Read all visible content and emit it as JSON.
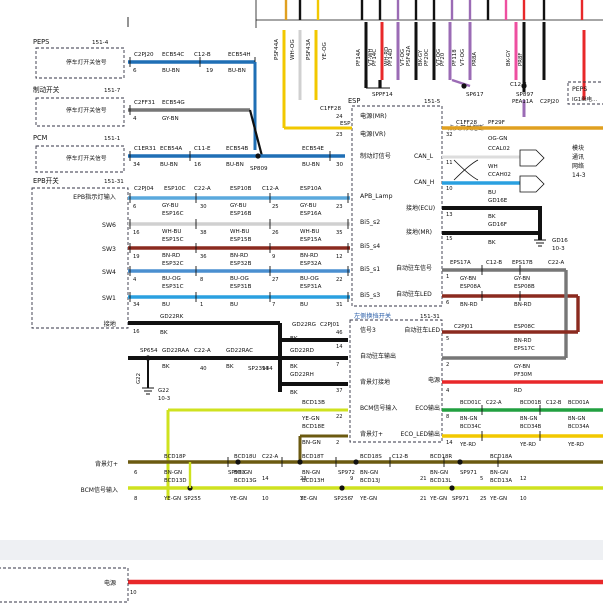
{
  "colors": {
    "BU-BN": "#1f6fb5",
    "GY-BN": "#777777",
    "BU-GY": "#5aa9dd",
    "WH-BU": "#d0d0d0",
    "BN-RD": "#8b2a1f",
    "BU-OG": "#4a8fd0",
    "BU": "#2aa0e0",
    "BK": "#111111",
    "YE-GN": "#cfe21f",
    "BN-GN": "#6b5a10",
    "RD": "#e8282a",
    "OG-GN": "#e0a020",
    "GN-BN": "#22a040",
    "YE-RD": "#f2c800",
    "VT-OG": "#9b6bb5",
    "BK-GY": "#333333",
    "PK": "#ee4fa0"
  },
  "modules": [
    {
      "name": "PEPS",
      "conn": "151-4",
      "label": "停车灯开关信号"
    },
    {
      "name": "制动开关",
      "conn": "151-7",
      "label": "停车灯开关信号"
    },
    {
      "name": "PCM",
      "conn": "151-1",
      "label": "停车灯开关信号"
    },
    {
      "name": "EPB开关",
      "conn": "151-31"
    }
  ],
  "epb_pins": [
    "EPB指示灯输入",
    "SW6",
    "SW3",
    "SW4",
    "SW1",
    "接地"
  ],
  "esp": {
    "name": "ESP",
    "conn": "151-5",
    "pins": [
      "电源(MR)",
      "电源(VR)",
      "制动灯信号",
      "APB_Lamp",
      "Bi5_s2",
      "Bi5_s4",
      "Bi5_s1",
      "Bi5_s3"
    ]
  },
  "switch_box": {
    "title": "左侧换挡开关",
    "conn": "151-31",
    "pins": [
      "信号3",
      "自动驻车输出",
      "背景灯接地",
      "BCM信号输入",
      "背景灯+"
    ],
    "right_pins": [
      "自动驻车LED",
      "ECO输出",
      "ECO_LED输出"
    ]
  },
  "right_labels": [
    "点火开关熔断",
    "CAN_L",
    "CAN_H",
    "接地(ECU)",
    "接地(MR)",
    "自动驻车信号",
    "自动驻车LED",
    "电源"
  ],
  "lower_left_labels": [
    "背景灯+",
    "BCM信号输入"
  ],
  "bottom_label": "电源",
  "module_right": {
    "name": "PEPS",
    "label": "IG1继电..."
  },
  "can_note": [
    "模块",
    "通讯",
    "网络",
    "14-3"
  ],
  "ground_notes": {
    "g22": "G22",
    "g22_ref": "10-3",
    "gd16": "GD16",
    "gd16_ref": "10-3"
  },
  "top_wires": [
    "PSF44A",
    "WH-OG",
    "PSF43A",
    "YE-OG",
    "PF14A",
    "VT-WH",
    "PF14C",
    "WH-RD",
    "PF14D",
    "VT-OG",
    "PSF42A",
    "BK-GY",
    "PF20C",
    "VT-OG",
    "PF20",
    "PF118",
    "VT-OG",
    "PR8A",
    "BK-GY",
    "PR8F"
  ],
  "top_splices": [
    "SPPF14",
    "SP617",
    "C12-B",
    "SP897",
    "PEA11A",
    "C2PJ20"
  ],
  "wire_labels": {
    "peps_row": [
      "C2PJ20",
      "ECB54C",
      "C12-B",
      "ECB54H",
      "BU-BN",
      "BU-BN"
    ],
    "brake_row": [
      "C2FF31",
      "ECB54G",
      "GY-BN"
    ],
    "pcm_row": [
      "C1ER31",
      "ECB54A",
      "C11-E",
      "ECB54B",
      "BU-BN",
      "BU-BN",
      "SP809",
      "ECB54E",
      "BU-BN"
    ],
    "epb_hdr": [
      "C2PJ04",
      "ESP10C",
      "C22-A",
      "ESP10B",
      "C12-A",
      "ESP10A"
    ],
    "r1": [
      "GY-BU",
      "ESP16C",
      "GY-BU",
      "ESP16B",
      "GY-BU",
      "ESP16A"
    ],
    "r2": [
      "WH-BU",
      "ESP15C",
      "WH-BU",
      "ESP15B",
      "WH-BU",
      "ESP15A"
    ],
    "r3": [
      "BN-RD",
      "ESP32C",
      "BN-RD",
      "ESP32B",
      "BN-RD",
      "ESP32A"
    ],
    "r4": [
      "BU-OG",
      "ESP31C",
      "BU-OG",
      "ESP31B",
      "BU-OG",
      "ESP31A"
    ],
    "r5": [
      "BU",
      "BU",
      "BU"
    ],
    "gnd_row": [
      "GD22RK",
      "BK",
      "GD22RG",
      "C2PJ01"
    ],
    "sp": [
      "SP654",
      "GD22RAA",
      "C22-A",
      "GD22RAC",
      "SP23934"
    ],
    "right_top": [
      "C1FF28",
      "PF29F",
      "OG-GN",
      "CCAL02",
      "WH",
      "CCAH02",
      "BU",
      "GD16E",
      "BK",
      "GD16F",
      "BK"
    ],
    "epb_right": [
      "EPS17A",
      "C12-B",
      "EPS17B",
      "C22-A",
      "GY-BN",
      "GY-BN",
      "ESP08A",
      "ESP08B",
      "BN-RD",
      "BN-RD"
    ],
    "sw_right": [
      "C2PJ01",
      "ESP08C",
      "BN-RD",
      "EPS17C",
      "GY-BN",
      "PF30M",
      "RD"
    ],
    "eco": [
      "BCD01C",
      "C22-A",
      "BCD01B",
      "C12-B",
      "BCD01A",
      "BN-GN",
      "BN-GN",
      "BN-GN",
      "BCD34C",
      "BCD34B",
      "BCD34A",
      "YE-RD",
      "YE-RD",
      "YE-RD"
    ],
    "bcm": [
      "BCD13B",
      "YE-GN",
      "BCD18E",
      "BN-GN"
    ],
    "back": [
      "BCD18P",
      "SP973",
      "BCD18U",
      "C22-A",
      "BCD18T",
      "SP972",
      "BCD18S",
      "C12-B",
      "BCD18R",
      "SP971",
      "BCD18A"
    ],
    "back2": [
      "BN-GN",
      "BCD13D",
      "BN-GN",
      "BCD13G",
      "BN-GN",
      "BCD13H",
      "BN-GN",
      "BCD13J",
      "BN-GN",
      "BCD13L",
      "BN-GN",
      "BCD13A"
    ],
    "yg": [
      "YE-GN",
      "SP255",
      "YE-GN",
      "YE-GN",
      "SP256",
      "YE-GN",
      "YE-GN",
      "SP971",
      "YE-GN"
    ],
    "misc": [
      "ESP",
      "C1FF28",
      "SP23934",
      "BK",
      "BK",
      "GD22RD",
      "GD22RH",
      "BK"
    ]
  },
  "pin_numbers": [
    "6",
    "16",
    "19",
    "4",
    "34",
    "16",
    "30",
    "38",
    "36",
    "8",
    "1",
    "25",
    "26",
    "9",
    "27",
    "7",
    "23",
    "35",
    "12",
    "22",
    "31",
    "24",
    "23",
    "32",
    "11",
    "10",
    "13",
    "15",
    "1",
    "6",
    "5",
    "2",
    "4",
    "8",
    "14",
    "46",
    "14",
    "7",
    "37",
    "22",
    "2",
    "40",
    "14",
    "14",
    "23",
    "9",
    "21",
    "5",
    "10",
    "3",
    "7",
    "21",
    "25",
    "12",
    "10"
  ]
}
